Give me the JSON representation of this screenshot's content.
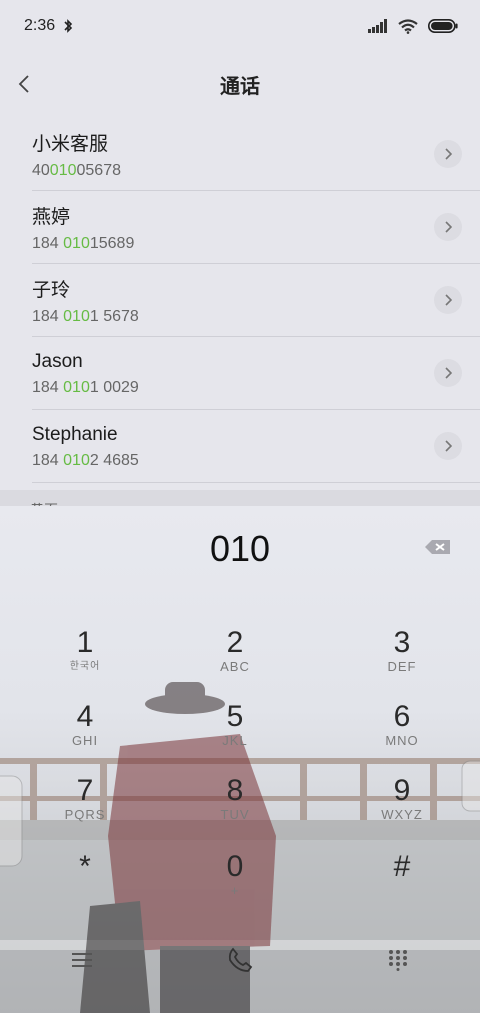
{
  "status_bar": {
    "time": "2:36",
    "bluetooth_icon": "bluetooth-icon",
    "signal_icon": "signal-icon",
    "wifi_icon": "wifi-icon",
    "battery_icon": "battery-icon"
  },
  "header": {
    "title": "通话",
    "back_icon": "chevron-left-icon"
  },
  "contacts": [
    {
      "name": "小米客服",
      "number_pre": "40",
      "number_match": "010",
      "number_post": "05678"
    },
    {
      "name": "燕婷",
      "number_pre": "184 ",
      "number_match": "010",
      "number_post": "15689"
    },
    {
      "name": "子玲",
      "number_pre": "184 ",
      "number_match": "010",
      "number_post": "1 5678"
    },
    {
      "name": "Jason",
      "number_pre": "184 ",
      "number_match": "010",
      "number_post": "1 0029"
    },
    {
      "name": "Stephanie",
      "number_pre": "184 ",
      "number_match": "010",
      "number_post": "2 4685"
    }
  ],
  "section_label": "黄页",
  "dialer": {
    "input_value": "010",
    "keys": [
      {
        "digit": "1",
        "letters": "한국어"
      },
      {
        "digit": "2",
        "letters": "ABC"
      },
      {
        "digit": "3",
        "letters": "DEF"
      },
      {
        "digit": "4",
        "letters": "GHI"
      },
      {
        "digit": "5",
        "letters": "JKL"
      },
      {
        "digit": "6",
        "letters": "MNO"
      },
      {
        "digit": "7",
        "letters": "PQRS"
      },
      {
        "digit": "8",
        "letters": "TUV"
      },
      {
        "digit": "9",
        "letters": "WXYZ"
      },
      {
        "digit": "*",
        "letters": ""
      },
      {
        "digit": "0",
        "letters": "+"
      },
      {
        "digit": "#",
        "letters": ""
      }
    ],
    "bottom_icons": [
      "menu-icon",
      "phone-icon",
      "keypad-icon"
    ]
  },
  "colors": {
    "match_highlight": "#66bb44",
    "background": "#e6e6ec"
  }
}
